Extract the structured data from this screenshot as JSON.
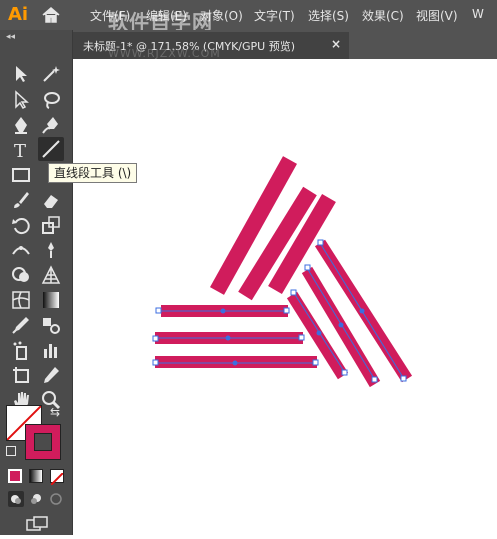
{
  "app": {
    "logo": "Ai"
  },
  "menu": [
    {
      "label": "文件(F)"
    },
    {
      "label": "编辑(E)"
    },
    {
      "label": "对象(O)"
    },
    {
      "label": "文字(T)"
    },
    {
      "label": "选择(S)"
    },
    {
      "label": "效果(C)"
    },
    {
      "label": "视图(V)"
    }
  ],
  "watermark": {
    "text": "软件自学网",
    "url": "WWW.RJZXW.COM"
  },
  "document_tab": {
    "title": "未标题-1* @ 171.58% (CMYK/GPU 预览)",
    "close": "×"
  },
  "tooltip": {
    "text": "直线段工具 (\\)"
  },
  "tools": {
    "collapse": "◂◂",
    "type_glyph": "T"
  },
  "colors": {
    "shape_fill": "#d01c5c",
    "path_stroke": "#3b6ee0",
    "anchor": "#3b6ee0",
    "ui_dark": "#535353",
    "toolbar": "#4b4b4b"
  }
}
